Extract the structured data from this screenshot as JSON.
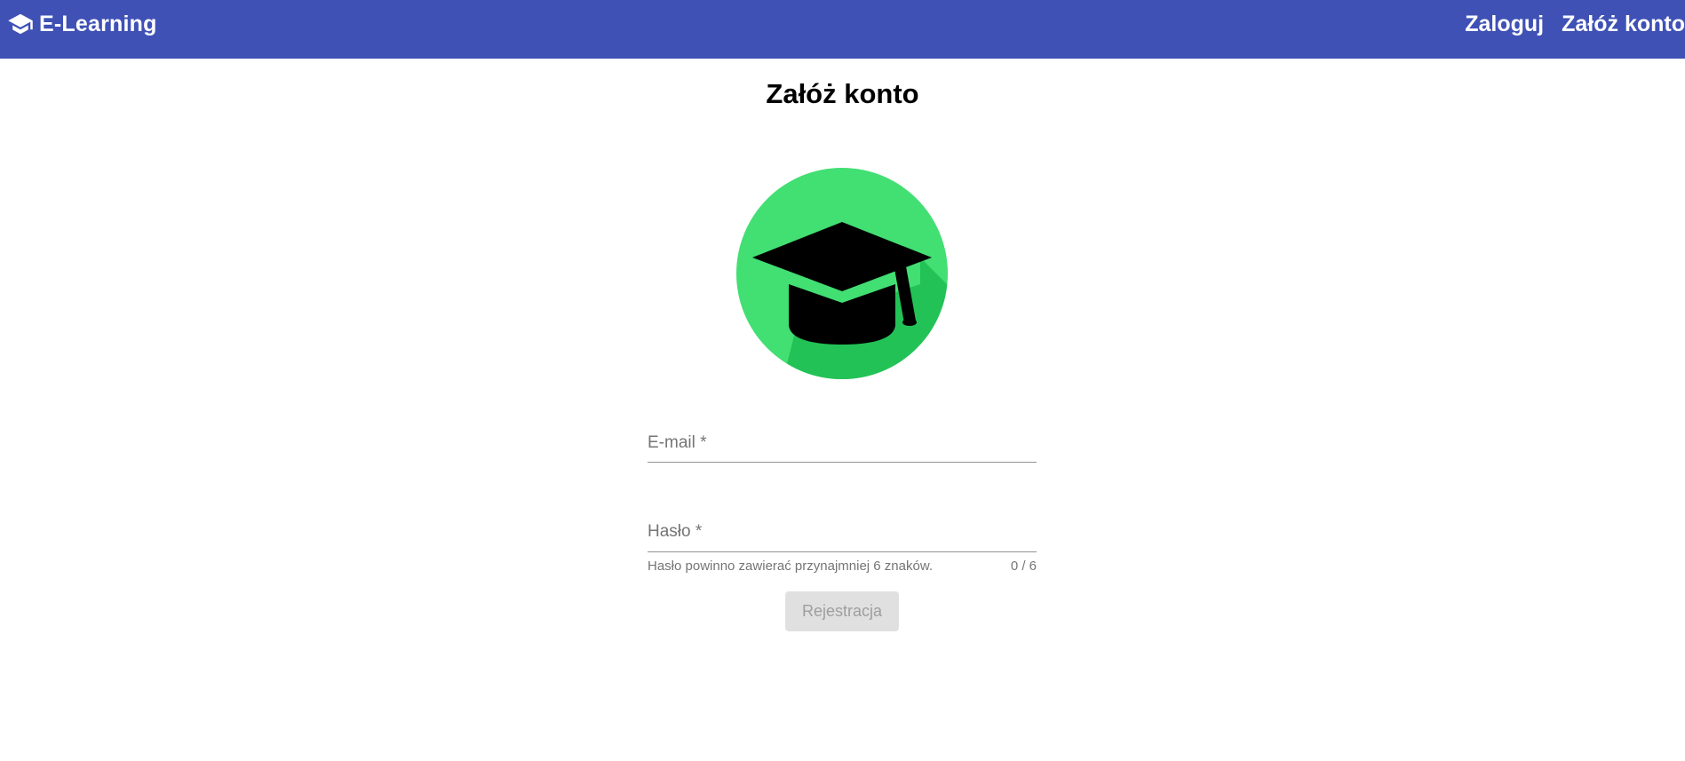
{
  "header": {
    "brand_title": "E-Learning",
    "brand_icon": "graduation-cap-icon",
    "nav": {
      "login_label": "Zaloguj",
      "register_label": "Załóż konto"
    },
    "background_color": "#3f51b5"
  },
  "main": {
    "title": "Załóż konto",
    "logo_icon": "graduation-cap-circle-icon",
    "logo_colors": {
      "circle": "#42df73",
      "shadow": "#23c256",
      "cap": "#000000"
    },
    "form": {
      "email": {
        "label": "E-mail *",
        "value": ""
      },
      "password": {
        "label": "Hasło *",
        "value": "",
        "hint": "Hasło powinno zawierać przynajmniej 6 znaków.",
        "counter": "0 / 6"
      },
      "submit_label": "Rejestracja",
      "submit_disabled": true
    }
  }
}
